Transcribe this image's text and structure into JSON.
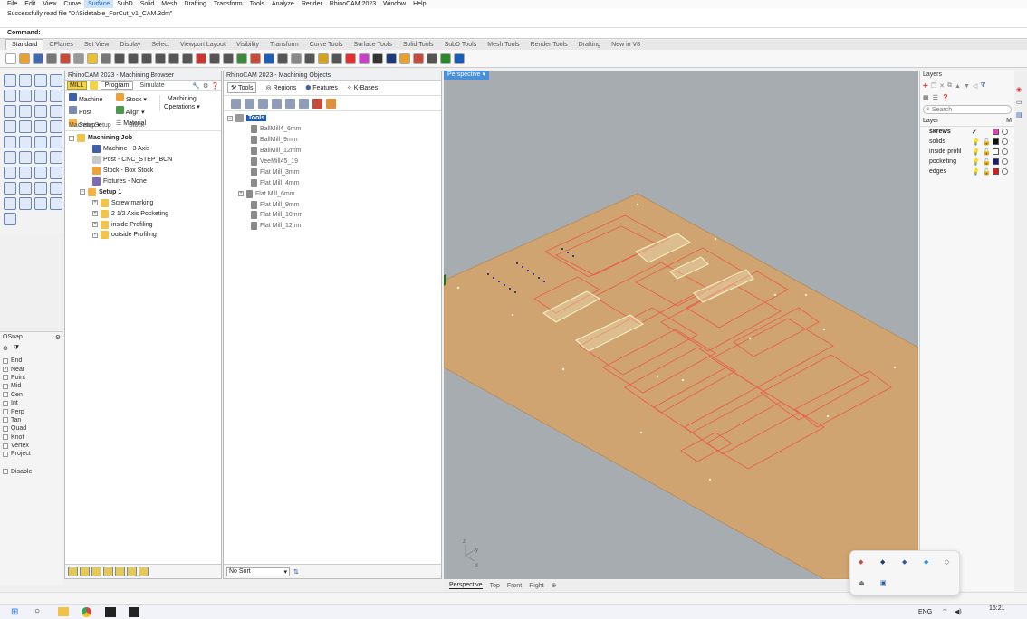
{
  "menu": [
    "File",
    "Edit",
    "View",
    "Curve",
    "Surface",
    "SubD",
    "Solid",
    "Mesh",
    "Drafting",
    "Transform",
    "Tools",
    "Analyze",
    "Render",
    "RhinoCAM 2023",
    "Window",
    "Help"
  ],
  "menu_active": "Surface",
  "command_history": "Successfully read file \"D:\\Sidetable_ForCut_v1_CAM.3dm\"",
  "command_label": "Command:",
  "toolbar_tabs": [
    "Standard",
    "CPlanes",
    "Set View",
    "Display",
    "Select",
    "Viewport Layout",
    "Visibility",
    "Transform",
    "Curve Tools",
    "Surface Tools",
    "Solid Tools",
    "SubD Tools",
    "Mesh Tools",
    "Render Tools",
    "Drafting",
    "New in V8"
  ],
  "toolbar_tab_active": "Standard",
  "machining_browser": {
    "title": "RhinoCAM 2023 - Machining Browser",
    "mode": "MILL",
    "tabs": [
      "Program",
      "Simulate"
    ],
    "ribbon": {
      "machine": "Machine",
      "post": "Post",
      "setup": "Setup",
      "stock": "Stock",
      "align": "Align",
      "material": "Material",
      "machining_ops_1": "Machining",
      "machining_ops_2": "Operations",
      "group_machine_setup": "Machine Setup",
      "group_stock": "Stock"
    },
    "tree": {
      "root": "Machining Job",
      "machine": "Machine - 3 Axis",
      "post": "Post - CNC_STEP_BCN",
      "stock": "Stock - Box Stock",
      "fixtures": "Fixtures - None",
      "setup": "Setup 1",
      "operations": [
        "Screw marking",
        "2 1/2 Axis Pocketing",
        "inside Profiling",
        "outside Profiling"
      ]
    }
  },
  "machining_objects": {
    "title": "RhinoCAM 2023 - Machining Objects",
    "tabs": [
      "Tools",
      "Regions",
      "Features",
      "K-Bases"
    ],
    "root": "Tools",
    "tools": [
      "BallMill4_6mm",
      "BallMill_9mm",
      "BallMill_12mm",
      "VeeMill45_19",
      "Flat Mill_3mm",
      "Flat Mill_4mm",
      "Flat Mill_6mm",
      "Flat Mill_9mm",
      "Flat Mill_10mm",
      "Flat Mill_12mm"
    ],
    "sort": "No Sort"
  },
  "viewport": {
    "active": "Perspective",
    "tabs": [
      "Perspective",
      "Top",
      "Front",
      "Right"
    ],
    "axis_labels": {
      "z": "z",
      "y": "y",
      "x": "x"
    }
  },
  "osnap": {
    "title": "OSnap",
    "items": [
      {
        "label": "End",
        "checked": false
      },
      {
        "label": "Near",
        "checked": true
      },
      {
        "label": "Point",
        "checked": false
      },
      {
        "label": "Mid",
        "checked": false
      },
      {
        "label": "Cen",
        "checked": false
      },
      {
        "label": "Int",
        "checked": false
      },
      {
        "label": "Perp",
        "checked": false
      },
      {
        "label": "Tan",
        "checked": false
      },
      {
        "label": "Quad",
        "checked": false
      },
      {
        "label": "Knot",
        "checked": false
      },
      {
        "label": "Vertex",
        "checked": false
      },
      {
        "label": "Project",
        "checked": false
      }
    ],
    "disable": "Disable"
  },
  "layers": {
    "title": "Layers",
    "search_placeholder": "Search",
    "col_layer": "Layer",
    "col_m": "M",
    "items": [
      {
        "name": "skrews",
        "color": "#e83fb0",
        "current": true
      },
      {
        "name": "solids",
        "color": "#111111",
        "current": false
      },
      {
        "name": "inside profil",
        "color": "#ffffff",
        "current": false
      },
      {
        "name": "pocketing",
        "color": "#1a1a7a",
        "current": false
      },
      {
        "name": "edges",
        "color": "#e01818",
        "current": false
      }
    ]
  },
  "tray": {
    "time": "16:21",
    "lang": "ENG"
  },
  "colors": {
    "stock": "#cfa470",
    "cut": "#e8604a",
    "pocket": "#f4efc2",
    "viewport_bg": "#a7acb1",
    "accent": "#4a8fd9"
  }
}
